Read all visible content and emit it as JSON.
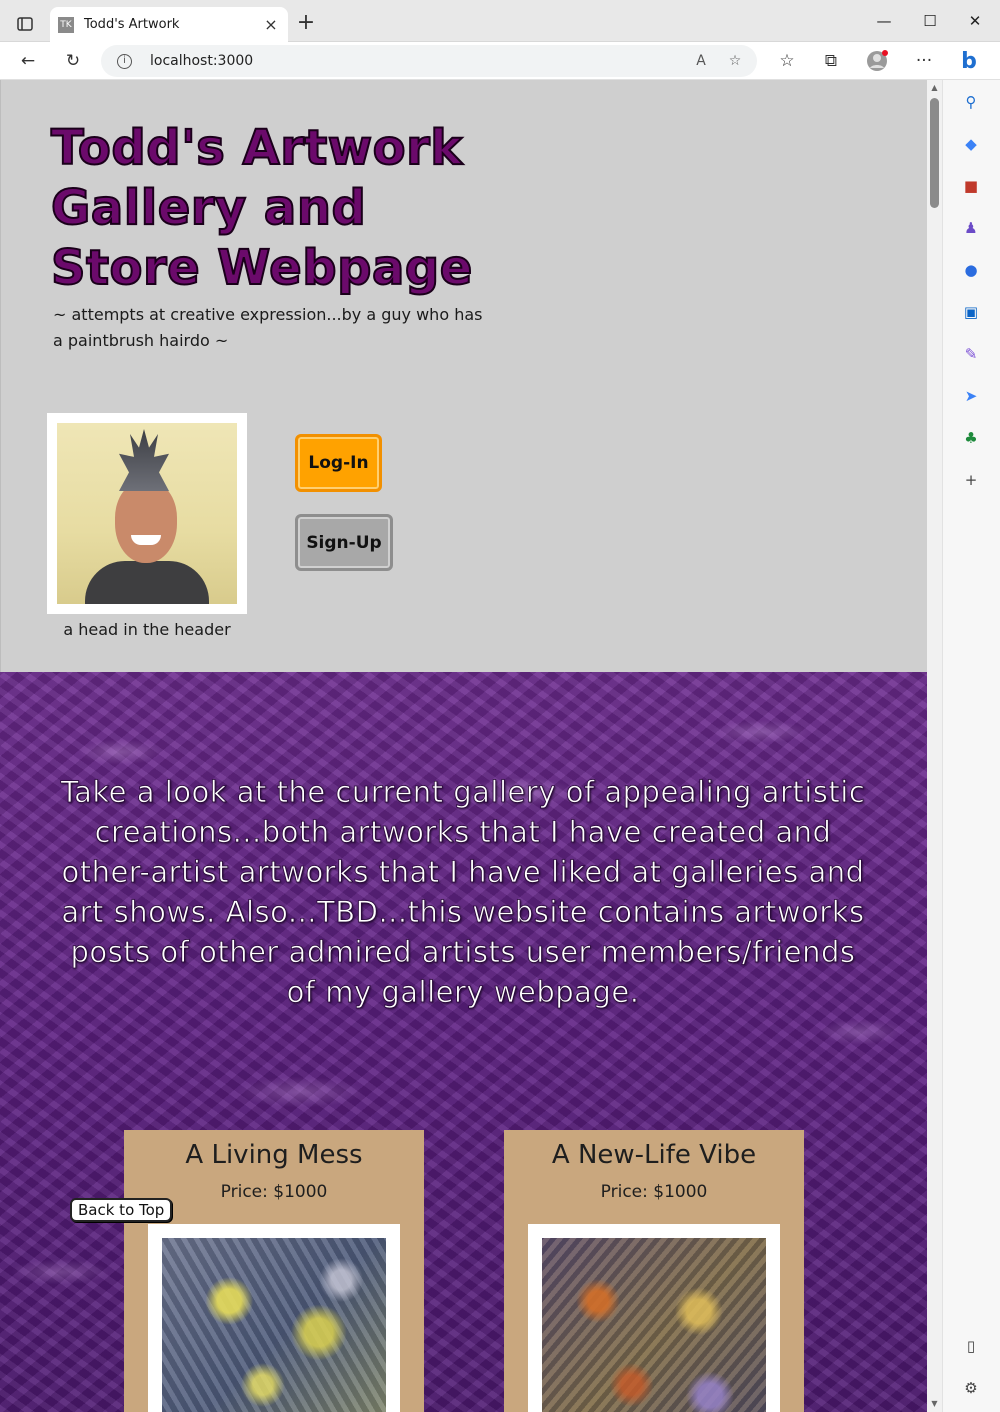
{
  "browser": {
    "tab_title": "Todd's Artwork",
    "favicon_text": "TK",
    "url": "localhost:3000",
    "icons": {
      "tab_actions": "tab-actions-icon",
      "close_tab": "close-icon",
      "new_tab": "plus-icon",
      "minimize": "minimize-icon",
      "maximize": "maximize-icon",
      "close_window": "close-icon",
      "back": "back-arrow-icon",
      "refresh": "refresh-icon",
      "info": "info-icon",
      "read_aloud": "read-aloud-icon",
      "add_favorite": "star-plus-icon",
      "favorites": "favorites-icon",
      "collections": "collections-icon",
      "profile": "profile-icon",
      "more": "more-icon",
      "copilot": "bing-icon"
    },
    "glyphs": {
      "close_tab": "×",
      "new_tab": "+",
      "minimize": "—",
      "maximize": "☐",
      "close_window": "✕",
      "back": "←",
      "refresh": "↻",
      "info": "i",
      "read_aloud": "A",
      "add_favorite": "☆",
      "favorites": "☆",
      "collections": "⧉",
      "more": "···",
      "copilot": "b"
    }
  },
  "edge_sidebar": {
    "items": [
      {
        "name": "search-icon",
        "glyph": "⚲",
        "color": "#1f6fd0"
      },
      {
        "name": "shopping-tag-icon",
        "glyph": "◆",
        "color": "#3b82f6"
      },
      {
        "name": "tools-icon",
        "glyph": "■",
        "color": "#c0392b"
      },
      {
        "name": "games-icon",
        "glyph": "♟",
        "color": "#6b4bc7"
      },
      {
        "name": "office-icon",
        "glyph": "●",
        "color": "#2b6cdf"
      },
      {
        "name": "outlook-icon",
        "glyph": "▣",
        "color": "#0a64c7"
      },
      {
        "name": "designer-icon",
        "glyph": "✎",
        "color": "#7b4fd6"
      },
      {
        "name": "send-icon",
        "glyph": "➤",
        "color": "#3b82f6"
      },
      {
        "name": "tree-icon",
        "glyph": "♣",
        "color": "#1e8a3c"
      },
      {
        "name": "add-icon",
        "glyph": "+",
        "color": "#444444"
      }
    ],
    "bottom": [
      {
        "name": "sidebar-toggle-icon",
        "glyph": "▯",
        "color": "#444444"
      },
      {
        "name": "settings-icon",
        "glyph": "⚙",
        "color": "#444444"
      }
    ]
  },
  "header": {
    "title": "Todd's Artwork Gallery and Store Webpage",
    "subtitle": "~ attempts at creative expression...by a guy who has a paintbrush hairdo ~",
    "portrait_caption": "a head in the header",
    "login_label": "Log-In",
    "signup_label": "Sign-Up"
  },
  "gallery": {
    "intro_text": "Take a look at the current gallery of appealing artistic creations...both artworks that I have created and other-artist artworks that I have liked at galleries and art shows. Also...TBD...this website contains artworks posts of other admired artists user members/friends of my gallery webpage.",
    "artworks": [
      {
        "title": "A Living Mess",
        "price": "Price: $1000"
      },
      {
        "title": "A New-Life Vibe",
        "price": "Price: $1000"
      }
    ],
    "back_to_top_label": "Back to Top"
  },
  "colors": {
    "title_purple": "#6b0a6b",
    "header_gray": "#cfcfcf",
    "login_orange": "#ffa200",
    "signup_gray": "#a8a8a8",
    "gallery_purple": "#5d1f82",
    "card_tan": "#c9a77e"
  }
}
